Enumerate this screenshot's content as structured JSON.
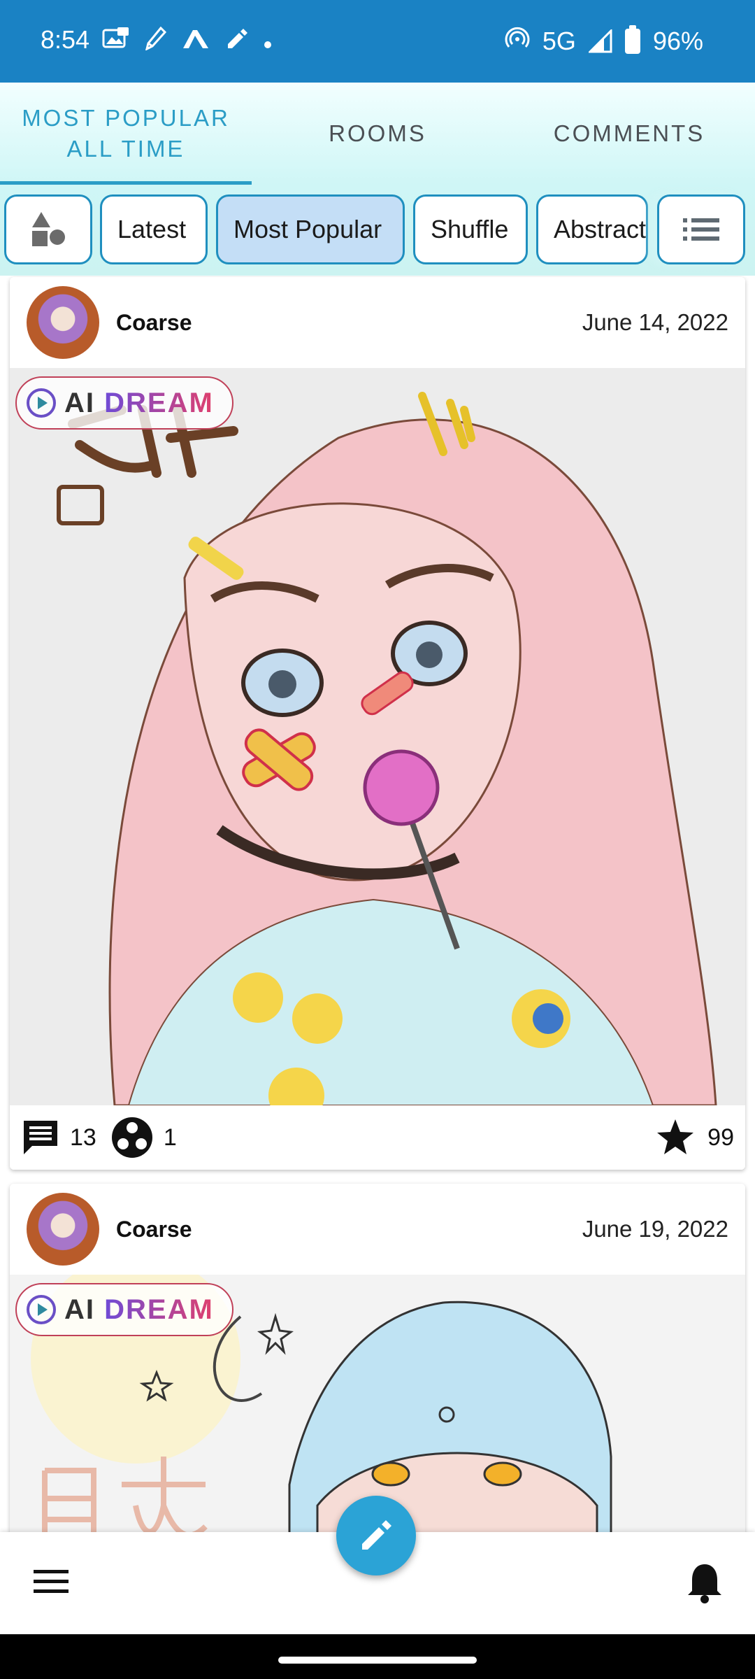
{
  "status_bar": {
    "time": "8:54",
    "network": "5G",
    "battery": "96%",
    "left_icons": [
      "photo-notification-icon",
      "pen-nib-icon",
      "app-a-icon",
      "pencil-icon",
      "dot-icon"
    ],
    "right_icons": [
      "hotspot-icon",
      "signal-icon",
      "battery-icon"
    ]
  },
  "tabs": [
    {
      "label": "MOST POPULAR ALL TIME",
      "active": true
    },
    {
      "label": "ROOMS",
      "active": false
    },
    {
      "label": "COMMENTS",
      "active": false
    }
  ],
  "filters": {
    "chips": [
      "Latest",
      "Most Popular",
      "Shuffle",
      "Abstract"
    ],
    "selected": "Most Popular"
  },
  "posts": [
    {
      "author": "Coarse",
      "date": "June 14, 2022",
      "badge": {
        "prefix": "AI",
        "word": "DREAM"
      },
      "comments": "13",
      "remixes": "1",
      "stars": "99"
    },
    {
      "author": "Coarse",
      "date": "June 19, 2022",
      "badge": {
        "prefix": "AI",
        "word": "DREAM"
      }
    }
  ],
  "colors": {
    "status_bar": "#1a82c4",
    "accent": "#2b9dc6",
    "chip_border": "#1f8fbf",
    "chip_selected": "#c4def6",
    "fab": "#2ba3d6"
  }
}
